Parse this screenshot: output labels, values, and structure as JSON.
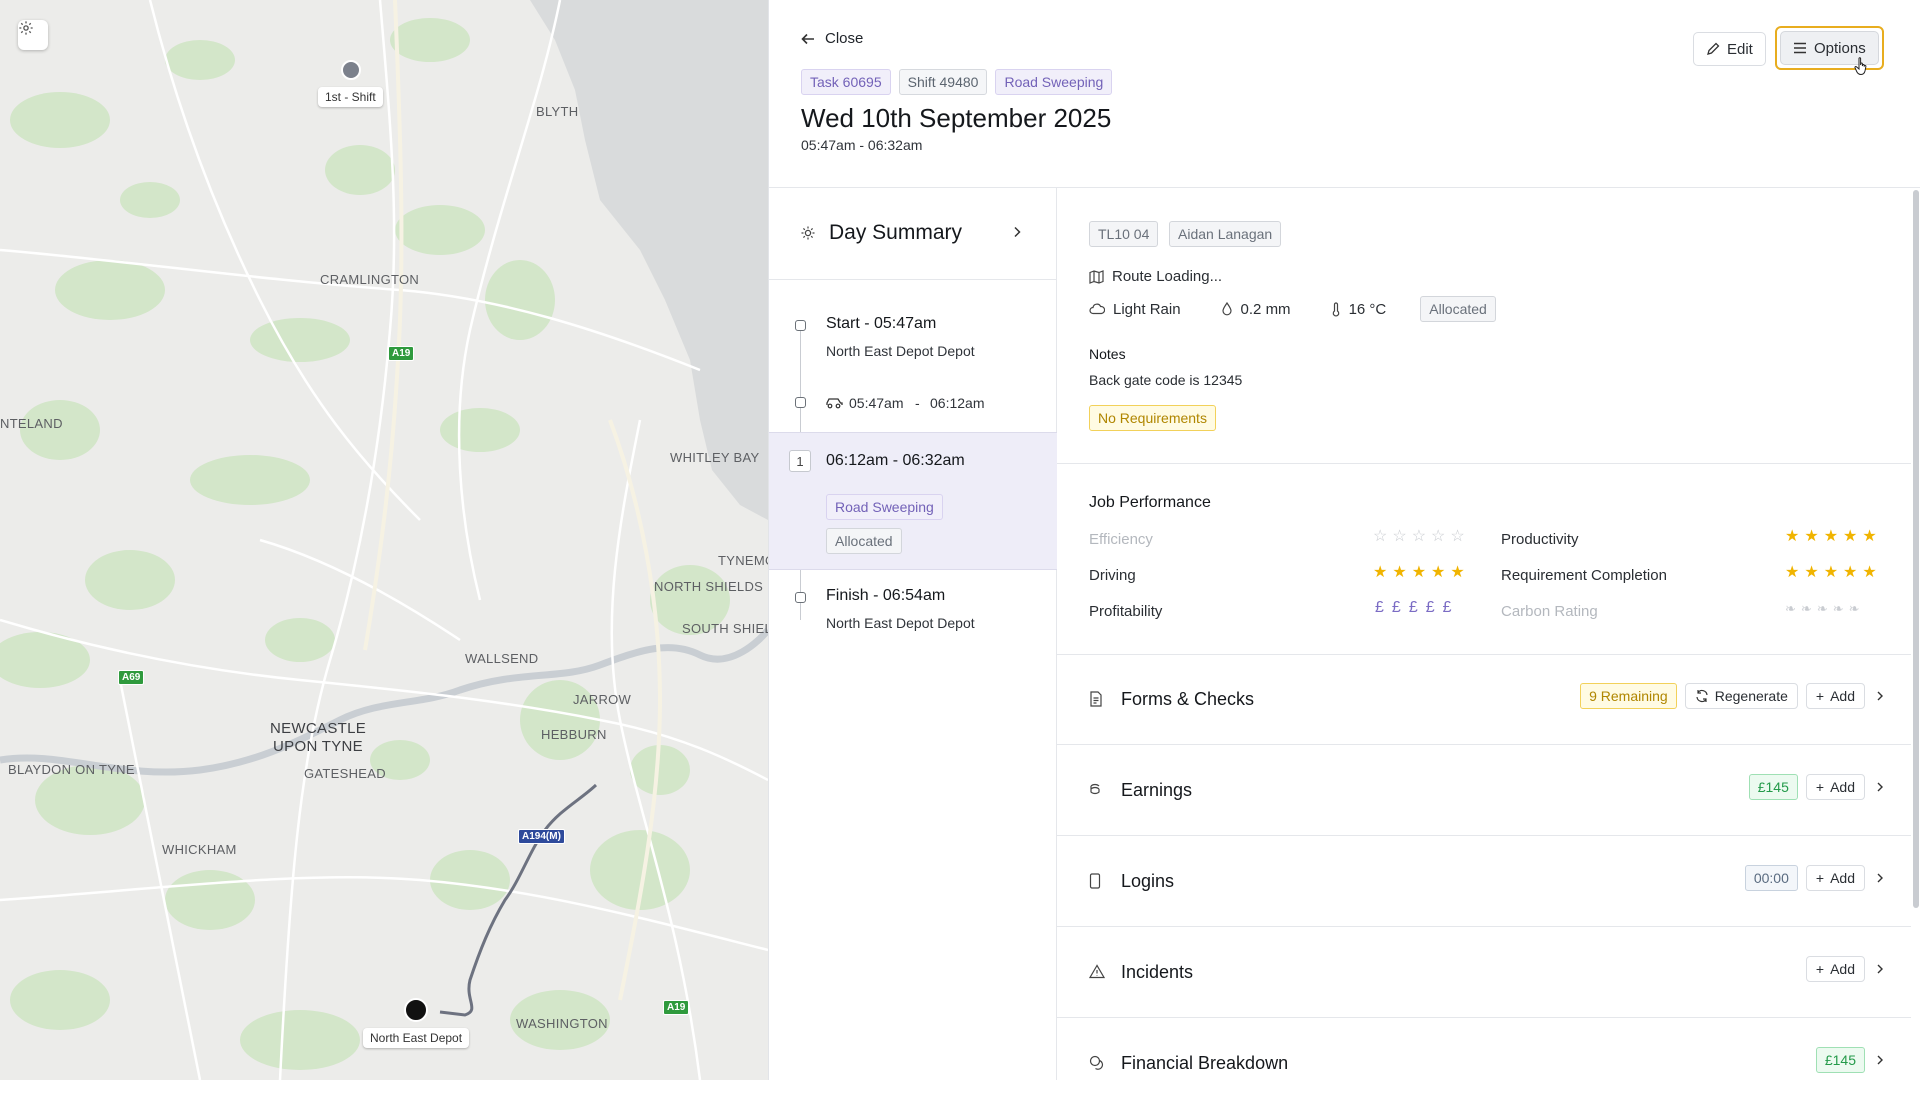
{
  "map": {
    "places": {
      "blyth": "BLYTH",
      "cramlington": "CRAMLINGTON",
      "ponteland": "NTELAND",
      "whitley_bay": "WHITLEY BAY",
      "tynemouth": "TYNEMO",
      "north_shields": "NORTH SHIELDS",
      "south_shields": "SOUTH SHIEL",
      "wallsend": "WALLSEND",
      "jarrow": "JARROW",
      "hebburn": "HEBBURN",
      "newcastle": "NEWCASTLE\nUPON TYNE",
      "gateshead": "GATESHEAD",
      "blaydon": "BLAYDON ON TYNE",
      "whickham": "WHICKHAM",
      "washington": "WASHINGTON"
    },
    "shields": {
      "a19_top": "A19",
      "a69": "A69",
      "a194m": "A194(M)",
      "a19_bottom": "A19"
    },
    "pins": {
      "shift": "1st - Shift",
      "depot": "North East Depot"
    }
  },
  "header": {
    "close_label": "Close",
    "chips": {
      "task": "Task 60695",
      "shift": "Shift 49480",
      "service": "Road Sweeping"
    },
    "title": "Wed 10th September 2025",
    "time_range": "05:47am - 06:32am",
    "edit_label": "Edit",
    "options_label": "Options"
  },
  "timeline": {
    "day_summary": "Day Summary",
    "start_title": "Start - 05:47am",
    "start_sub": "North East Depot Depot",
    "travel_from": "05:47am",
    "travel_sep": "-",
    "travel_to": "06:12am",
    "job_number": "1",
    "job_time": "06:12am - 06:32am",
    "job_service": "Road Sweeping",
    "job_status": "Allocated",
    "finish_title": "Finish - 06:54am",
    "finish_sub": "North East Depot Depot"
  },
  "details": {
    "vehicle": "TL10 04",
    "driver": "Aidan Lanagan",
    "route": "Route Loading...",
    "weather": "Light Rain",
    "rain": "0.2 mm",
    "temp": "16 °C",
    "status": "Allocated",
    "notes_label": "Notes",
    "notes_text": "Back gate code is 12345",
    "requirements": "No Requirements"
  },
  "performance": {
    "title": "Job Performance",
    "efficiency": {
      "label": "Efficiency",
      "rating": 0
    },
    "productivity": {
      "label": "Productivity",
      "rating": 5
    },
    "driving": {
      "label": "Driving",
      "rating": 5
    },
    "requirement_completion": {
      "label": "Requirement Completion",
      "rating": 5
    },
    "profitability": {
      "label": "Profitability",
      "rating": 5
    },
    "carbon": {
      "label": "Carbon Rating",
      "rating": 0
    }
  },
  "sections": {
    "forms": {
      "title": "Forms & Checks",
      "badge": "9 Remaining",
      "regenerate": "Regenerate",
      "add": "Add"
    },
    "earnings": {
      "title": "Earnings",
      "badge": "£145",
      "add": "Add"
    },
    "logins": {
      "title": "Logins",
      "badge": "00:00",
      "add": "Add"
    },
    "incidents": {
      "title": "Incidents",
      "add": "Add"
    },
    "financial": {
      "title": "Financial Breakdown",
      "badge": "£145"
    }
  },
  "colors": {
    "star": "#f0b400",
    "star_empty": "#c9ccd1",
    "pound": "#7b6cc4",
    "highlight": "#e8ad1f"
  }
}
